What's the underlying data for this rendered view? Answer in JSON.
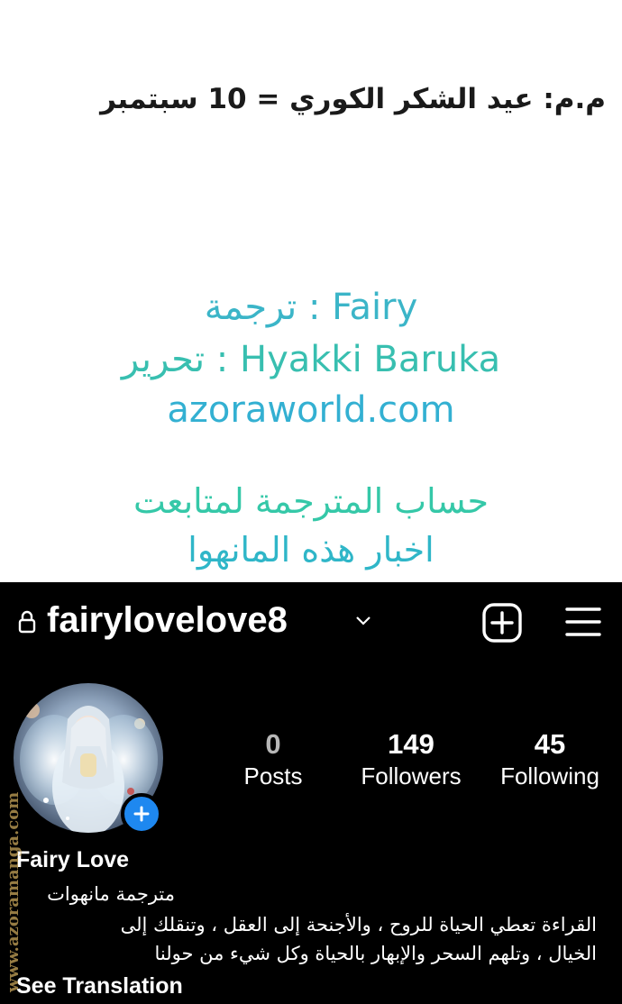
{
  "note": "م.م: عيد الشكر الكوري = 10 سبتمبر",
  "credits": {
    "translation": "ترجمة : Fairy",
    "editing": "تحرير : Hyakki Baruka",
    "website": "azoraworld.com",
    "follow_line1": "حساب المترجمة لمتابعت",
    "follow_line2": "اخبار هذه المانهوا"
  },
  "profile": {
    "username": "fairylovelove8",
    "stats": [
      {
        "value": "0",
        "label": "Posts"
      },
      {
        "value": "149",
        "label": "Followers"
      },
      {
        "value": "45",
        "label": "Following"
      }
    ],
    "name": "Fairy Love",
    "bio": [
      "مترجمة مانهوات",
      "القراءة تعطي الحياة للروح ، والأجنحة إلى العقل ، وتنقلك إلى",
      "الخيال ، وتلهم السحر والإبهار بالحياة وكل شيء من حولنا"
    ],
    "see_translation": "See Translation"
  },
  "watermark": "www.azoramanga.com",
  "colors": {
    "accent_teal": "#3bb5c8",
    "accent_green": "#35c8a8",
    "insta_blue": "#1e88f0",
    "watermark_gold": "#c9a65a"
  },
  "icons": [
    "lock-icon",
    "chevron-down-icon",
    "new-post-icon",
    "menu-icon",
    "add-story-icon"
  ]
}
